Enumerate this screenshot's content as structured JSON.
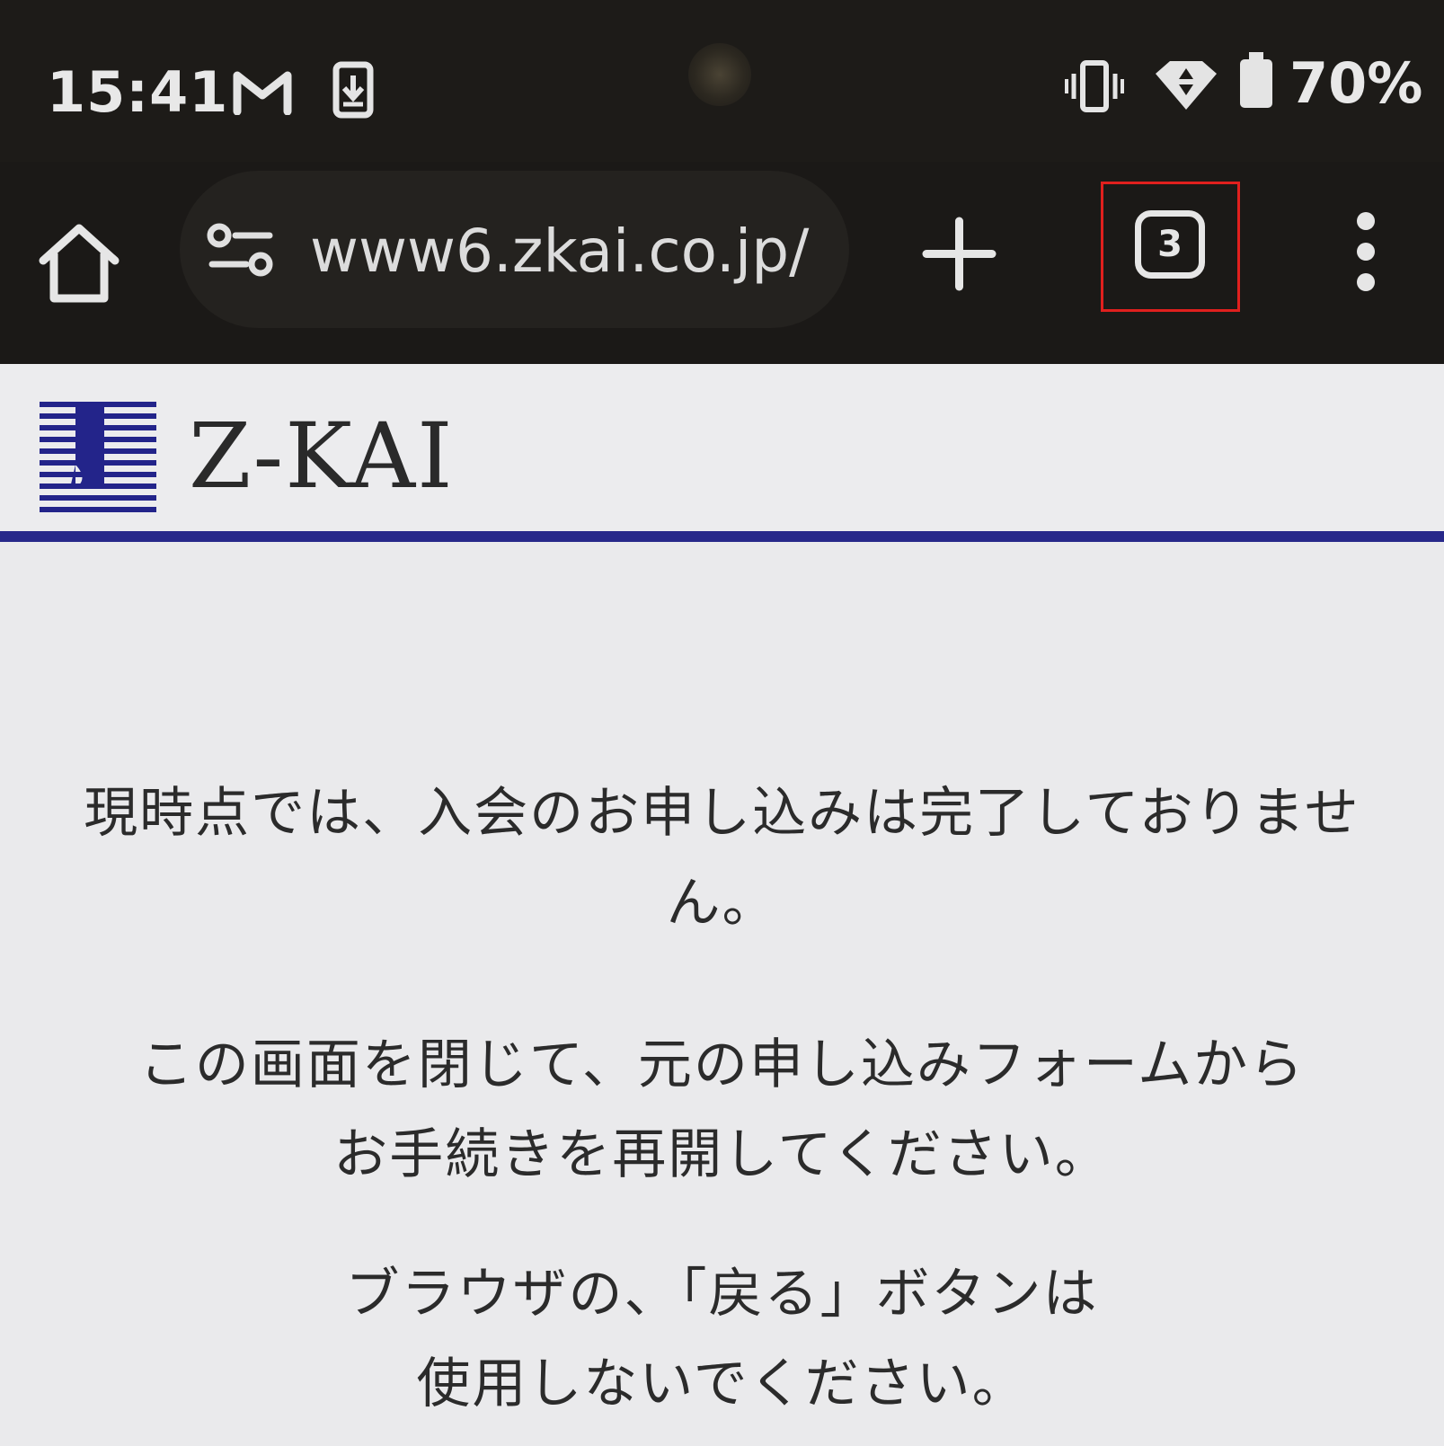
{
  "status_bar": {
    "time": "15:41",
    "notification_icons": [
      "gmail-icon",
      "download-icon"
    ],
    "system_icons": [
      "vibrate-icon",
      "wifi-icon",
      "battery-icon"
    ],
    "battery_text": "70%"
  },
  "browser": {
    "url": "www6.zkai.co.jp/",
    "tab_count": "3"
  },
  "site": {
    "logo_text": "Z-KAI",
    "brand_color": "#27288a"
  },
  "content": {
    "message_1": "現時点では、入会のお申し込みは完了しておりません。",
    "message_2_line1": "この画面を閉じて、元の申し込みフォームから",
    "message_2_line2": "お手続きを再開してください。",
    "message_3_line1": "ブラウザの、「戻る」ボタンは",
    "message_3_line2": "使用しないでください。"
  },
  "highlight": {
    "target": "tab-switcher-button",
    "color": "#e0201e"
  }
}
